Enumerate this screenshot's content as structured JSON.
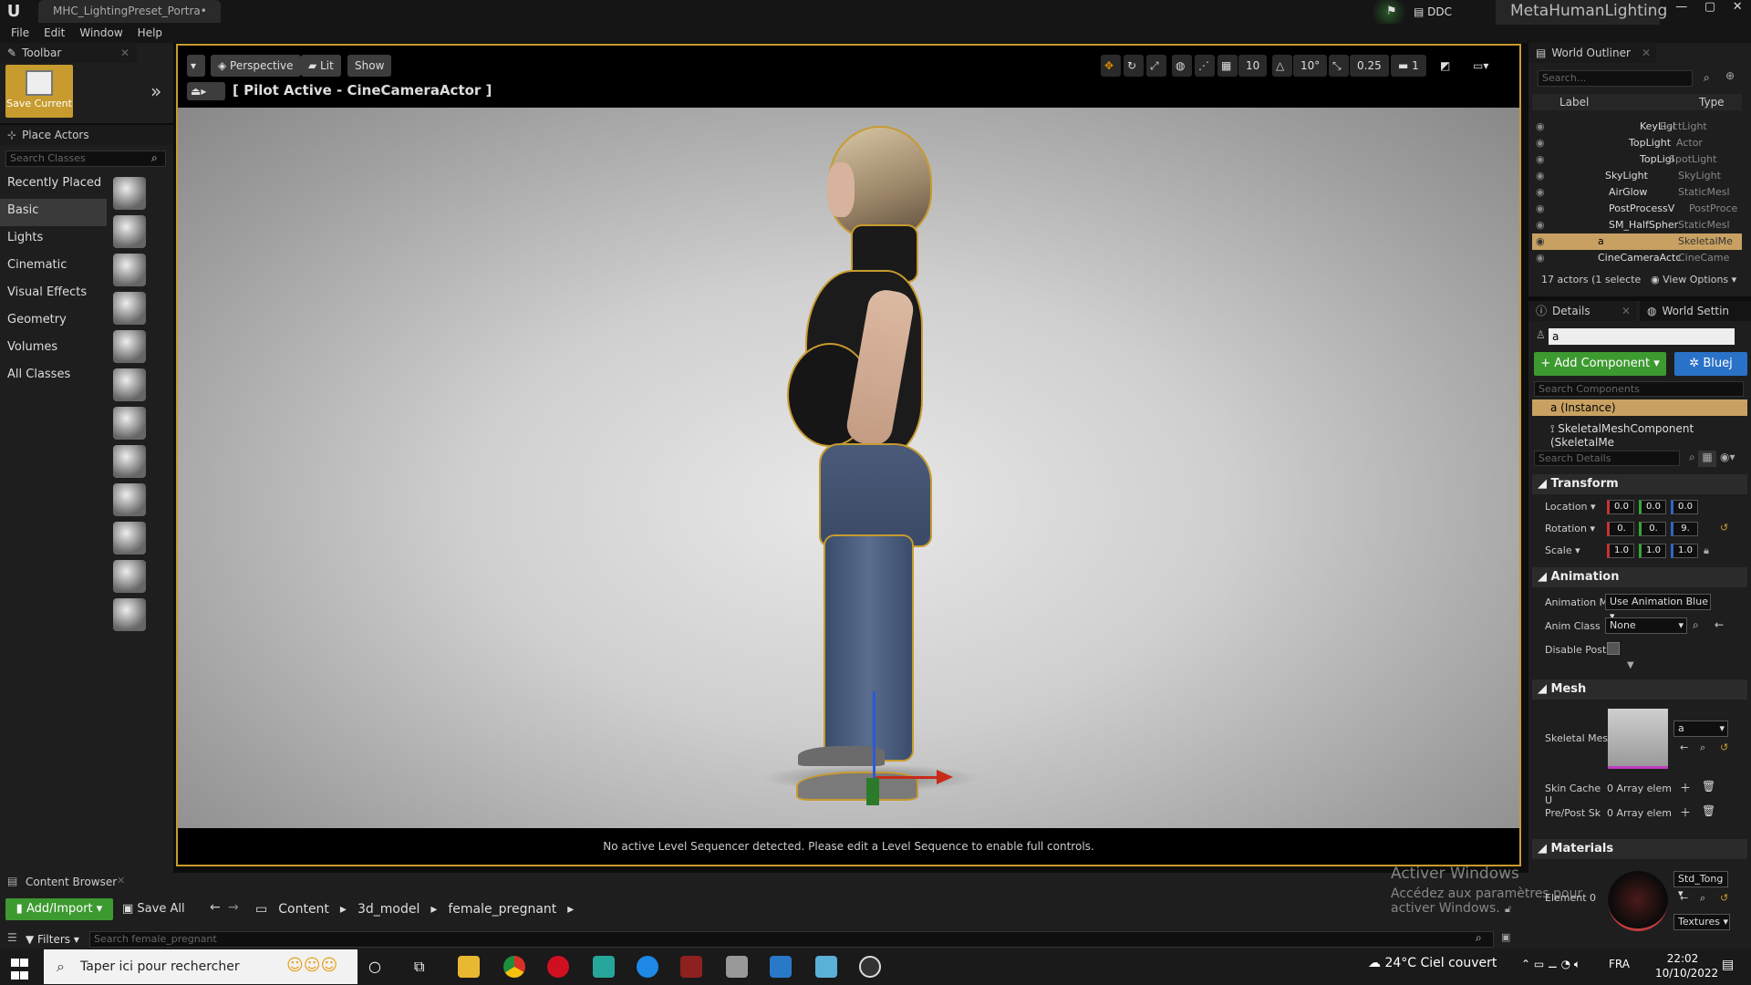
{
  "titlebar": {
    "doc_tab": "MHC_LightingPreset_Portra•",
    "ddc": "DDC",
    "project": "MetaHumanLighting",
    "win_min": "—",
    "win_max": "▢",
    "win_close": "✕"
  },
  "menu": [
    "File",
    "Edit",
    "Window",
    "Help"
  ],
  "toolbar": {
    "tab": "Toolbar",
    "save_current": "Save Current"
  },
  "place_actors": {
    "tab": "Place Actors",
    "search_placeholder": "Search Classes",
    "categories": [
      "Recently Placed",
      "Basic",
      "Lights",
      "Cinematic",
      "Visual Effects",
      "Geometry",
      "Volumes",
      "All Classes"
    ]
  },
  "viewport": {
    "perspective": "Perspective",
    "lit": "Lit",
    "show": "Show",
    "pilot": "[ Pilot Active - CineCameraActor ]",
    "grid_snap": "10",
    "rot_snap": "10°",
    "scale_snap": "0.25",
    "camera_speed": "1",
    "footer": "No active Level Sequencer detected. Please edit a Level Sequence to enable full controls."
  },
  "outliner": {
    "tab": "World Outliner",
    "search_placeholder": "Search...",
    "col_label": "Label",
    "col_type": "Type",
    "rows": [
      {
        "label": "KeyLigl",
        "type": "RectLight"
      },
      {
        "label": "TopLight",
        "type": "Actor"
      },
      {
        "label": "TopLigl",
        "type": "SpotLight"
      },
      {
        "label": "SkyLight",
        "type": "SkyLight"
      },
      {
        "label": "AirGlow",
        "type": "StaticMesl"
      },
      {
        "label": "PostProcessV",
        "type": "PostProce"
      },
      {
        "label": "SM_HalfSpher",
        "type": "StaticMesl"
      },
      {
        "label": "a",
        "type": "SkeletalMe"
      },
      {
        "label": "CineCameraActc",
        "type": "CineCame"
      }
    ],
    "status": "17 actors (1 selecte",
    "view_options": "View Options"
  },
  "details": {
    "tab": "Details",
    "world_settings_tab": "World Settin",
    "filter_value": "a",
    "add_component": "+ Add Component",
    "blueprint": "Bluej",
    "search_components": "Search Components",
    "instance": "a (Instance)",
    "skeletal_component": "SkeletalMeshComponent (SkeletalMe",
    "search_details": "Search Details",
    "transform": {
      "title": "Transform",
      "location_label": "Location",
      "rotation_label": "Rotation",
      "scale_label": "Scale",
      "location": [
        "0.0",
        "0.0",
        "0.0"
      ],
      "rotation": [
        "0.",
        "0.",
        "9."
      ],
      "scale": [
        "1.0",
        "1.0",
        "1.0"
      ]
    },
    "animation": {
      "title": "Animation",
      "mode_label": "Animation M",
      "mode_value": "Use Animation Blue",
      "class_label": "Anim Class",
      "class_value": "None",
      "disable_label": "Disable Post"
    },
    "mesh": {
      "title": "Mesh",
      "skeletal_label": "Skeletal Mes",
      "skeletal_value": "a",
      "skin_cache_label": "Skin Cache U",
      "skin_cache_value": "0 Array elem",
      "prepost_label": "Pre/Post Sk",
      "prepost_value": "0 Array elem"
    },
    "materials": {
      "title": "Materials",
      "element_label": "Element 0",
      "material_value": "Std_Tong",
      "textures": "Textures"
    }
  },
  "content_browser": {
    "tab": "Content Browser",
    "add_import": "Add/Import",
    "save_all": "Save All",
    "path": [
      "Content",
      "3d_model",
      "female_pregnant"
    ],
    "filters": "Filters",
    "search_placeholder": "Search female_pregnant"
  },
  "activate_windows": {
    "title": "Activer Windows",
    "subtitle": "Accédez aux paramètres pour activer Windows."
  },
  "taskbar": {
    "search_placeholder": "Taper ici pour rechercher",
    "weather": "24°C  Ciel couvert",
    "lang": "FRA",
    "time": "22:02",
    "date": "10/10/2022"
  }
}
